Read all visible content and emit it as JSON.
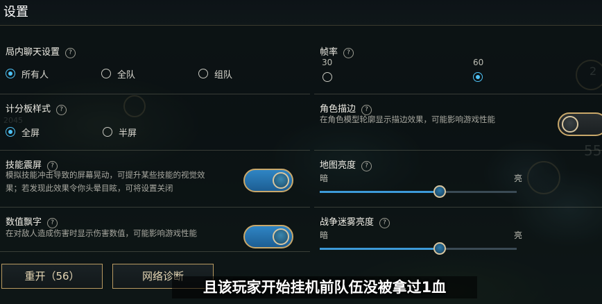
{
  "window": {
    "title": "设置"
  },
  "chat": {
    "label": "局内聊天设置",
    "help": "?",
    "options": [
      "所有人",
      "全队",
      "组队"
    ],
    "selected": "所有人"
  },
  "fps": {
    "label": "帧率",
    "help": "?",
    "options": [
      "30",
      "60"
    ],
    "selected": "60"
  },
  "scoreboard": {
    "label": "计分板样式",
    "help": "?",
    "options": [
      "全屏",
      "半屏"
    ],
    "selected": "全屏"
  },
  "outline": {
    "label": "角色描边",
    "help": "?",
    "desc": "在角色模型轮廓显示描边效果，可能影响游戏性能",
    "enabled": false
  },
  "shake": {
    "label": "技能震屏",
    "help": "?",
    "desc_line1": "模拟技能冲击导致的屏幕晃动，可提升某些技能的视觉效",
    "desc_line2": "果；若发现此效果令你头晕目眩，可将设置关闭",
    "enabled": true
  },
  "map_brightness": {
    "label": "地图亮度",
    "help": "?",
    "min_label": "暗",
    "max_label": "亮",
    "value": 0.61
  },
  "damage_numbers": {
    "label": "数值飘字",
    "help": "?",
    "desc": "在对敌人造成伤害时显示伤害数值，可能影响游戏性能",
    "enabled": true
  },
  "fog_brightness": {
    "label": "战争迷雾亮度",
    "help": "?",
    "min_label": "暗",
    "max_label": "亮",
    "value": 0.61
  },
  "buttons": {
    "restart": "重开（56）",
    "network": "网络诊断"
  },
  "subtitle": "且该玩家开始挂机前队伍没被拿过1血",
  "background_text": {
    "score": "2045",
    "hud_num": "55",
    "hud_num2": "2"
  },
  "colors": {
    "accent": "#4fc3f7",
    "gold_border": "#c9a86a",
    "toggle_on": "#2f85c4"
  }
}
